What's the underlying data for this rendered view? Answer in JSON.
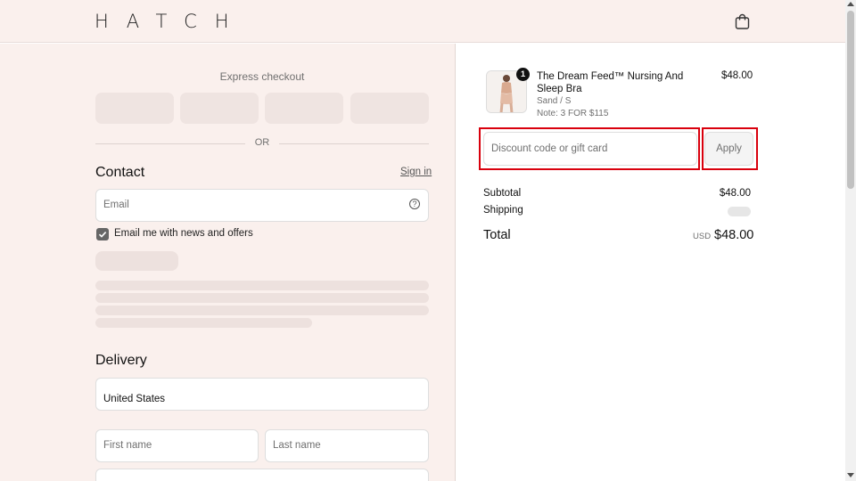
{
  "header": {
    "logo_text": "HATCH",
    "bag_icon": "shopping-bag-icon"
  },
  "checkout": {
    "express_label": "Express checkout",
    "or_text": "OR",
    "contact": {
      "title": "Contact",
      "signin_label": "Sign in",
      "email_placeholder": "Email",
      "help_icon": "question-circle-icon",
      "marketing_label": "Email me with news and offers",
      "marketing_checked": true
    },
    "delivery": {
      "title": "Delivery",
      "country_value": "United States",
      "first_name_placeholder": "First name",
      "last_name_placeholder": "Last name"
    }
  },
  "order_summary": {
    "item": {
      "quantity": "1",
      "name": "The Dream Feed™ Nursing And Sleep Bra",
      "variant": "Sand / S",
      "note": "Note: 3 FOR $115",
      "price": "$48.00"
    },
    "discount_placeholder": "Discount code or gift card",
    "apply_label": "Apply",
    "subtotal_label": "Subtotal",
    "subtotal_value": "$48.00",
    "shipping_label": "Shipping",
    "total_label": "Total",
    "total_currency": "USD",
    "total_value": "$48.00"
  },
  "colors": {
    "left_bg": "#faf0ed",
    "highlight": "#d9000d"
  }
}
